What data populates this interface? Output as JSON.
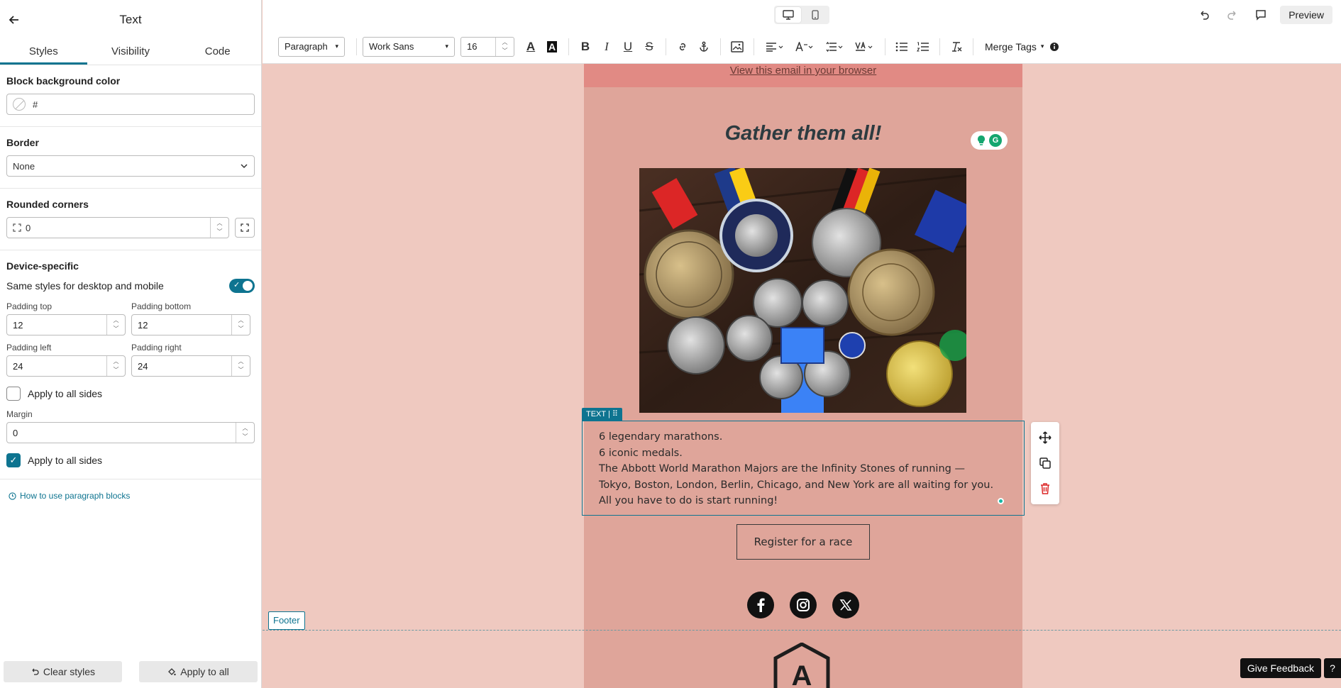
{
  "panel": {
    "title": "Text",
    "tabs": [
      "Styles",
      "Visibility",
      "Code"
    ],
    "bg_label": "Block background color",
    "bg_value": "#",
    "border_label": "Border",
    "border_value": "None",
    "rounded_label": "Rounded corners",
    "rounded_value": "0",
    "device_label": "Device-specific",
    "same_styles_label": "Same styles for desktop and mobile",
    "same_styles_on": true,
    "padding_top_label": "Padding top",
    "padding_top": "12",
    "padding_bottom_label": "Padding bottom",
    "padding_bottom": "12",
    "padding_left_label": "Padding left",
    "padding_left": "24",
    "padding_right_label": "Padding right",
    "padding_right": "24",
    "apply_sides_label": "Apply to all sides",
    "apply_sides_padding_checked": false,
    "margin_label": "Margin",
    "margin_value": "0",
    "apply_sides_margin_checked": true,
    "help_link": "How to use paragraph blocks",
    "clear_styles": "Clear styles",
    "apply_all": "Apply to all"
  },
  "topbar": {
    "preview": "Preview"
  },
  "toolbar": {
    "block_type": "Paragraph",
    "font": "Work Sans",
    "font_size": "16",
    "merge_tags": "Merge Tags"
  },
  "email": {
    "view_browser": "View this email in your browser",
    "headline": "Gather them all!",
    "text_label": "TEXT | ⠿",
    "lines": [
      "6 legendary marathons.",
      "6 iconic medals.",
      "The Abbott World Marathon Majors are the Infinity Stones of running —",
      "Tokyo, Boston, London, Berlin, Chicago, and New York are all waiting for you.",
      "All you have to do is start running!"
    ],
    "button": "Register for a race",
    "footer_tag": "Footer",
    "logo_letter": "A"
  },
  "feedback": "Give Feedback",
  "help": "?",
  "colors": {
    "accent": "#0e7490",
    "canvas": "#efc9c0",
    "email_bg": "#dfa59a",
    "top_strip": "#e18a84"
  }
}
